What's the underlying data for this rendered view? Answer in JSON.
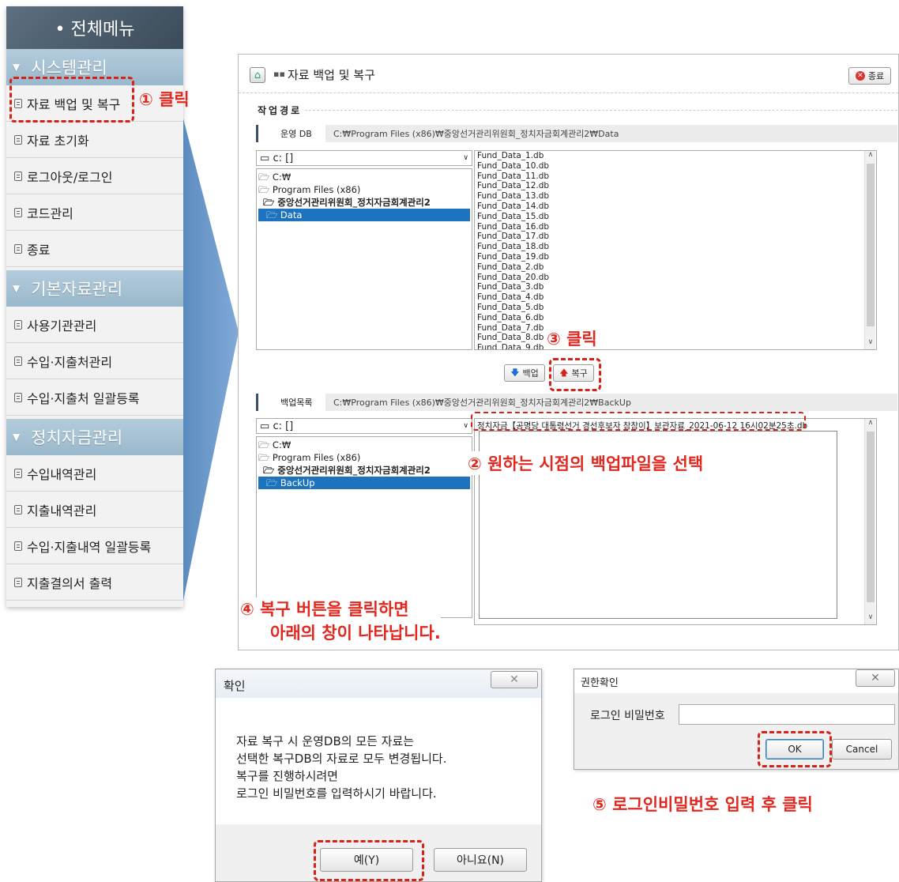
{
  "sidebar": {
    "title": "• 전체메뉴",
    "sections": [
      {
        "label": "시스템관리",
        "items": [
          "자료 백업 및 복구",
          "자료 초기화",
          "로그아웃/로그인",
          "코드관리",
          "종료"
        ]
      },
      {
        "label": "기본자료관리",
        "items": [
          "사용기관관리",
          "수입·지출처관리",
          "수입·지출처 일괄등록"
        ]
      },
      {
        "label": "정치자금관리",
        "items": [
          "수입내역관리",
          "지출내역관리",
          "수입·지출내역 일괄등록",
          "지출결의서 출력"
        ]
      }
    ]
  },
  "annotations": {
    "step1": "① 클릭",
    "step2": "② 원하는 시점의 백업파일을 선택",
    "step3": "③ 클릭",
    "step4_line1": "④ 복구 버튼을 클릭하면",
    "step4_line2": "아래의 창이 나타납니다.",
    "step5": "⑤ 로그인비밀번호 입력 후 클릭"
  },
  "window": {
    "title": "자료 백업 및 복구",
    "close_label": "종료",
    "group_label": "작업경로",
    "oper_db": {
      "label": "운영 DB",
      "path": "C:₩Program Files (x86)₩중앙선거관리위원회_정치자금회계관리2₩Data",
      "drive": "c: []",
      "tree": [
        "C:₩",
        "Program Files (x86)",
        "중앙선거관리위원회_정치자금회계관리2",
        "Data"
      ],
      "files": [
        "Fund_Data_1.db",
        "Fund_Data_10.db",
        "Fund_Data_11.db",
        "Fund_Data_12.db",
        "Fund_Data_13.db",
        "Fund_Data_14.db",
        "Fund_Data_15.db",
        "Fund_Data_16.db",
        "Fund_Data_17.db",
        "Fund_Data_18.db",
        "Fund_Data_19.db",
        "Fund_Data_2.db",
        "Fund_Data_20.db",
        "Fund_Data_3.db",
        "Fund_Data_4.db",
        "Fund_Data_5.db",
        "Fund_Data_6.db",
        "Fund_Data_7.db",
        "Fund_Data_8.db",
        "Fund_Data_9.db"
      ]
    },
    "backup_button": "백업",
    "restore_button": "복구",
    "backup_list": {
      "label": "백업목록",
      "path": "C:₩Program Files (x86)₩중앙선거관리위원회_정치자금회계관리2₩BackUp",
      "drive": "c: []",
      "tree": [
        "C:₩",
        "Program Files (x86)",
        "중앙선거관리위원회_정치자금회계관리2",
        "BackUp"
      ],
      "files": [
        "정치자금【공명당 대통령선거 경선후보자 참참이】보관자료_2021-06-12 16시02분25초.db"
      ]
    }
  },
  "confirm_dialog": {
    "title": "확인",
    "message": [
      "자료 복구 시 운영DB의 모든 자료는",
      "선택한 복구DB의 자료로 모두 변경됩니다.",
      "복구를 진행하시려면",
      "로그인 비밀번호를 입력하시기 바랍니다."
    ],
    "yes": "예(Y)",
    "no": "아니요(N)"
  },
  "auth_dialog": {
    "title": "권한확인",
    "field_label": "로그인 비밀번호",
    "password_value": "",
    "ok": "OK",
    "cancel": "Cancel"
  },
  "colors": {
    "accent_red": "#e0281f",
    "selection_blue": "#1e73be",
    "sidebar_section": "#9ab8cc"
  }
}
